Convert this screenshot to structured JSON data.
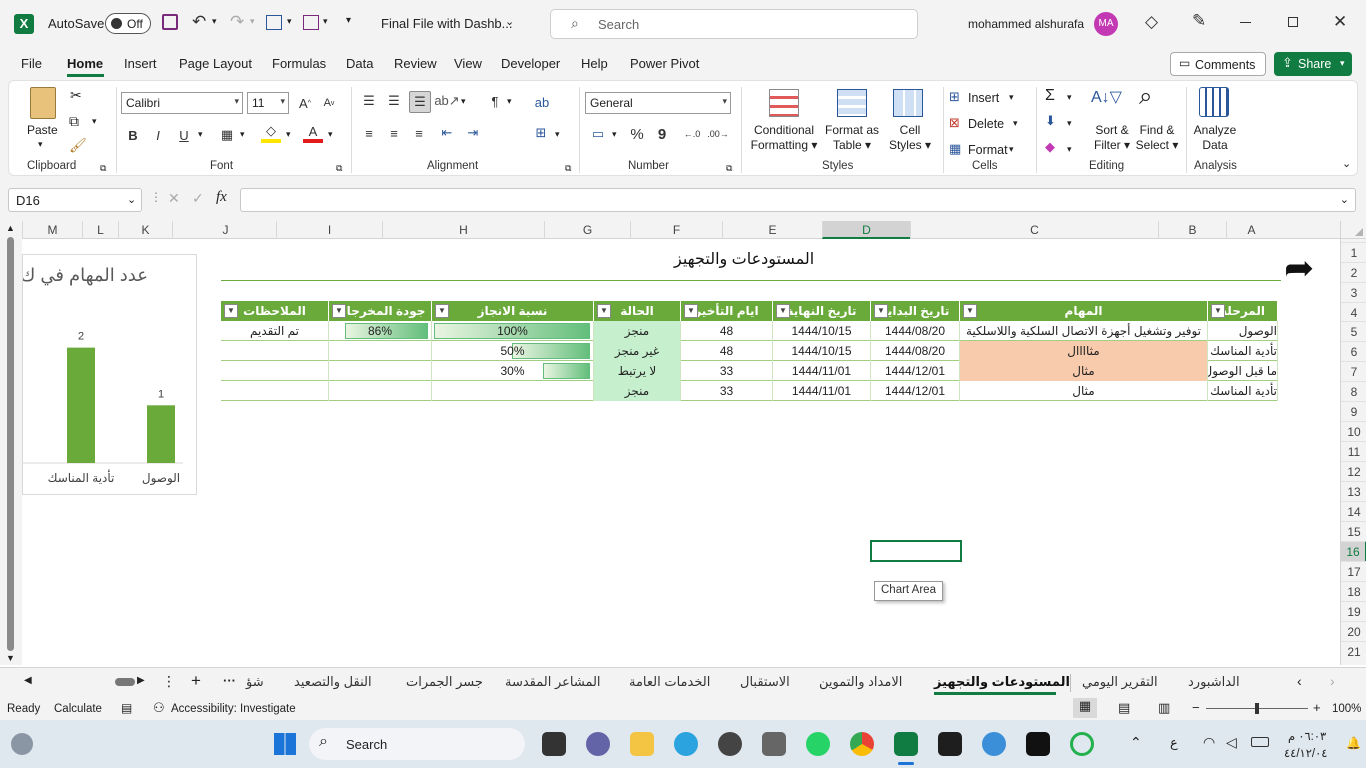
{
  "titlebar": {
    "autosave_label": "AutoSave",
    "autosave_state": "Off",
    "filename": "Final File with Dashb...",
    "search_placeholder": "Search",
    "user_name": "mohammed alshurafa",
    "user_initials": "MA"
  },
  "menu": {
    "tabs": [
      "File",
      "Home",
      "Insert",
      "Page Layout",
      "Formulas",
      "Data",
      "Review",
      "View",
      "Developer",
      "Help",
      "Power Pivot"
    ],
    "active": "Home",
    "comments_label": "Comments",
    "share_label": "Share"
  },
  "ribbon": {
    "clipboard": {
      "paste": "Paste",
      "label": "Clipboard"
    },
    "font": {
      "name": "Calibri",
      "size": "11",
      "label": "Font",
      "bold": "B",
      "italic": "I",
      "underline": "U"
    },
    "alignment": {
      "label": "Alignment"
    },
    "number": {
      "format": "General",
      "label": "Number"
    },
    "styles": {
      "conditional": "Conditional",
      "conditional2": "Formatting",
      "format_table": "Format as",
      "format_table2": "Table",
      "cell_styles": "Cell",
      "cell_styles2": "Styles",
      "label": "Styles"
    },
    "cells": {
      "insert": "Insert",
      "delete": "Delete",
      "format": "Format",
      "label": "Cells"
    },
    "editing": {
      "sort": "Sort &",
      "sort2": "Filter",
      "find": "Find &",
      "find2": "Select",
      "label": "Editing"
    },
    "analysis": {
      "analyze": "Analyze",
      "analyze2": "Data",
      "label": "Analysis"
    }
  },
  "formula_bar": {
    "name_box": "D16",
    "fx": "fx",
    "content": ""
  },
  "columns": [
    "M",
    "L",
    "K",
    "J",
    "I",
    "H",
    "G",
    "F",
    "E",
    "D",
    "C",
    "B",
    "A"
  ],
  "rows": [
    "1",
    "2",
    "3",
    "4",
    "5",
    "6",
    "7",
    "8",
    "9",
    "10",
    "11",
    "12",
    "13",
    "14",
    "15",
    "16",
    "17",
    "18",
    "19",
    "20",
    "21"
  ],
  "sheet": {
    "title": "المستودعات والتجهيز",
    "headers": [
      "المرحلة",
      "المهام",
      "تاريخ البداية",
      "تاريخ النهاية",
      "ايام التأخير",
      "الحالة",
      "نسبة الانجاز",
      "جودة المخرجات",
      "الملاحظات"
    ],
    "rows": [
      {
        "phase": "الوصول",
        "task": "توفير وتشغيل أجهزة الاتصال السلكية واللاسلكية",
        "start": "1444/08/20",
        "end": "1444/10/15",
        "delay": "48",
        "status": "منجز",
        "progress": "100%",
        "progress_value": 1.0,
        "quality": "86%",
        "quality_value": 0.86,
        "notes": "تم التقديم"
      },
      {
        "phase": "تأدية المناسك",
        "task": "مثاااال",
        "start": "1444/08/20",
        "end": "1444/10/15",
        "delay": "48",
        "status": "غير منجز",
        "progress": "50%",
        "progress_value": 0.5,
        "quality": "",
        "quality_value": 0,
        "notes": ""
      },
      {
        "phase": "ما قبل الوصول",
        "task": "مثال",
        "start": "1444/12/01",
        "end": "1444/11/01",
        "delay": "33",
        "status": "لا يرتبط",
        "progress": "30%",
        "progress_value": 0.3,
        "quality": "",
        "quality_value": 0,
        "notes": ""
      },
      {
        "phase": "تأدية المناسك",
        "task": "مثال",
        "start": "1444/12/01",
        "end": "1444/11/01",
        "delay": "33",
        "status": "منجز",
        "progress": "",
        "progress_value": 0,
        "quality": "",
        "quality_value": 0,
        "notes": ""
      }
    ],
    "tooltip": "Chart Area"
  },
  "chart_data": {
    "type": "bar",
    "title": "عدد المهام في ك",
    "categories": [
      "الوصول",
      "تأدية المناسك"
    ],
    "values": [
      1,
      2
    ],
    "ylim": [
      0,
      2.6
    ],
    "color": "#6aaa3a"
  },
  "sheet_tabs": {
    "tabs": [
      "الداشبورد",
      "التقرير اليومي",
      "المستودعات والتجهيز",
      "الامداد والتموين",
      "الاستقبال",
      "الخدمات العامة",
      "المشاعر المقدسة",
      "جسر الجمرات",
      "النقل والتصعيد",
      "شؤ"
    ],
    "active": "المستودعات والتجهيز"
  },
  "status": {
    "ready": "Ready",
    "calculate": "Calculate",
    "accessibility": "Accessibility: Investigate",
    "zoom": "100%"
  },
  "taskbar": {
    "search": "Search",
    "lang": "ع",
    "time": "٠٦:٠٣ م",
    "date": "٤٤/١٢/٠٤"
  },
  "colors": {
    "accent": "#107c41",
    "header_green": "#6aaa3a",
    "done_bg": "#c6efce",
    "warn_bg": "#f8cbad"
  }
}
